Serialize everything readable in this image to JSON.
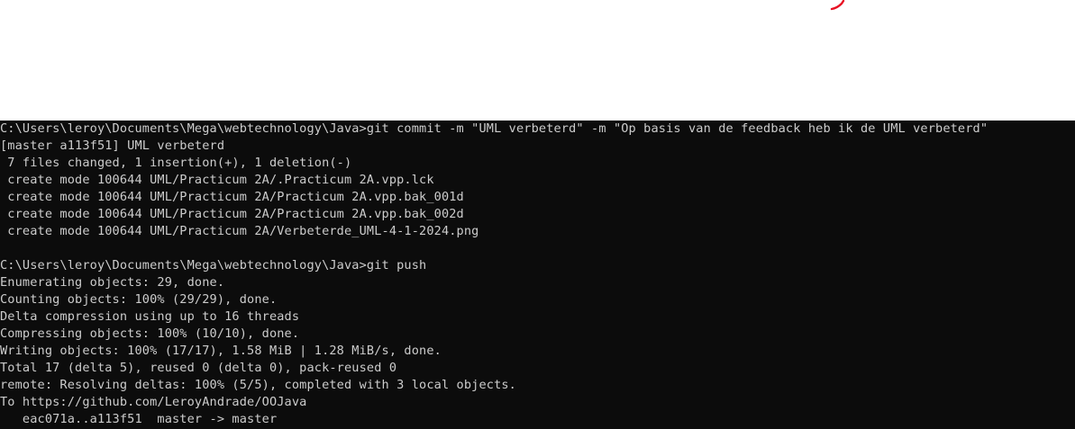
{
  "colors": {
    "background": "#0c0c0c",
    "text": "#cccccc",
    "top_area": "#ffffff",
    "mark": "#e81123"
  },
  "terminal": {
    "lines": [
      "C:\\Users\\leroy\\Documents\\Mega\\webtechnology\\Java>git commit -m \"UML verbeterd\" -m \"Op basis van de feedback heb ik de UML verbeterd\"",
      "[master a113f51] UML verbeterd",
      " 7 files changed, 1 insertion(+), 1 deletion(-)",
      " create mode 100644 UML/Practicum 2A/.Practicum 2A.vpp.lck",
      " create mode 100644 UML/Practicum 2A/Practicum 2A.vpp.bak_001d",
      " create mode 100644 UML/Practicum 2A/Practicum 2A.vpp.bak_002d",
      " create mode 100644 UML/Practicum 2A/Verbeterde_UML-4-1-2024.png",
      "",
      "C:\\Users\\leroy\\Documents\\Mega\\webtechnology\\Java>git push",
      "Enumerating objects: 29, done.",
      "Counting objects: 100% (29/29), done.",
      "Delta compression using up to 16 threads",
      "Compressing objects: 100% (10/10), done.",
      "Writing objects: 100% (17/17), 1.58 MiB | 1.28 MiB/s, done.",
      "Total 17 (delta 5), reused 0 (delta 0), pack-reused 0",
      "remote: Resolving deltas: 100% (5/5), completed with 3 local objects.",
      "To https://github.com/LeroyAndrade/OOJava",
      "   eac071a..a113f51  master -> master"
    ]
  }
}
